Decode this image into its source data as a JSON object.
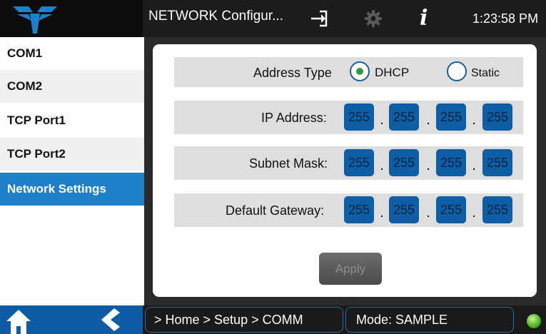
{
  "header": {
    "logo": "teledyne-logo",
    "title": "NETWORK Configur...",
    "icons": [
      "exit-icon",
      "gear-icon",
      "info-icon"
    ],
    "info_glyph": "i",
    "time": "1:23:58 PM"
  },
  "sidebar": {
    "items": [
      {
        "label": "COM1"
      },
      {
        "label": "COM2"
      },
      {
        "label": "TCP Port1"
      },
      {
        "label": "TCP Port2"
      },
      {
        "label": "Network Settings",
        "active": true
      }
    ]
  },
  "network": {
    "address_type_label": "Address Type",
    "options": [
      {
        "label": "DHCP",
        "selected": true
      },
      {
        "label": "Static",
        "selected": false
      }
    ],
    "ip": {
      "label": "IP Address:",
      "octets": [
        "255",
        "255",
        "255",
        "255"
      ]
    },
    "subnet": {
      "label": "Subnet Mask:",
      "octets": [
        "255",
        "255",
        "255",
        "255"
      ]
    },
    "gateway": {
      "label": "Default Gateway:",
      "octets": [
        "255",
        "255",
        "255",
        "255"
      ]
    },
    "separator": ".",
    "apply_label": "Apply",
    "apply_enabled": false
  },
  "footer": {
    "icons": [
      "home-icon",
      "back-icon"
    ],
    "breadcrumb": "> Home > Setup > COMM",
    "mode": "Mode: SAMPLE",
    "status": "green"
  },
  "colors": {
    "accent": "#1f7fc9",
    "octet_bg": "#0e5ea6",
    "radio_selected": "#2e9b3e",
    "status_led": "#4caf1e"
  }
}
